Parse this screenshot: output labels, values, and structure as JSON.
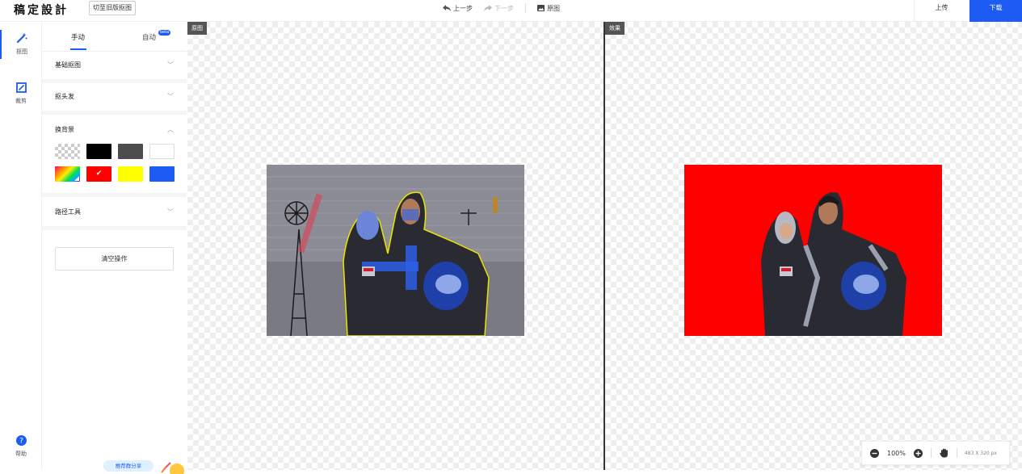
{
  "app": {
    "logo": "稿定設計",
    "switch_old": "切至旧版抠图"
  },
  "toolbar": {
    "undo": "上一步",
    "redo": "下一步",
    "original": "原图",
    "upload": "上传",
    "download": "下载"
  },
  "iconbar": {
    "items": [
      {
        "label": "抠图",
        "icon": "magic-wand-icon"
      },
      {
        "label": "裁剪",
        "icon": "crop-icon"
      }
    ],
    "help": "帮助"
  },
  "panel": {
    "tabs": [
      {
        "label": "手动"
      },
      {
        "label": "自动",
        "badge": "beta"
      }
    ],
    "sections": [
      {
        "title": "基础抠图",
        "expanded": false
      },
      {
        "title": "抠头发",
        "expanded": false
      },
      {
        "title": "换背景",
        "expanded": true
      },
      {
        "title": "路径工具",
        "expanded": false
      }
    ],
    "background_swatches": [
      {
        "name": "transparent",
        "color": "transparent"
      },
      {
        "name": "black",
        "color": "#000000"
      },
      {
        "name": "dark-gray",
        "color": "#4d4d4d"
      },
      {
        "name": "white",
        "color": "#ffffff"
      },
      {
        "name": "custom-color",
        "color": "gradient"
      },
      {
        "name": "red",
        "color": "#ff0000",
        "selected": true
      },
      {
        "name": "yellow",
        "color": "#ffff00"
      },
      {
        "name": "blue",
        "color": "#1d5bf5"
      }
    ],
    "clear_button": "清空操作",
    "promo": "推荐群分享"
  },
  "canvas": {
    "original_tag": "原图",
    "result_tag": "效果"
  },
  "zoom": {
    "level": "100%",
    "dims": "483 X 320 px"
  },
  "colors": {
    "accent": "#1d5bf5",
    "result_bg": "#ff0000"
  }
}
